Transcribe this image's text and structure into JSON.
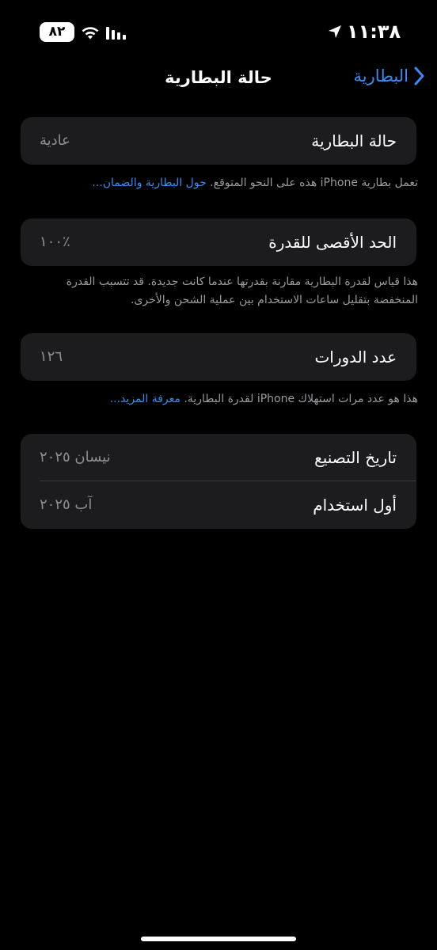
{
  "status_bar": {
    "time": "١١:٣٨",
    "battery_level": "٨٢",
    "location_icon": "location-arrow-icon",
    "wifi_icon": "wifi-icon",
    "signal_icon": "cellular-signal-icon"
  },
  "nav": {
    "title": "حالة البطارية",
    "back_label": "البطارية",
    "back_icon": "chevron-left-icon"
  },
  "sections": {
    "health": {
      "label": "حالة البطارية",
      "value": "عادية",
      "footnote_text": "تعمل بطارية iPhone هذه على النحو المتوقع. ",
      "footnote_link": "حول البطارية والضمان..."
    },
    "max_capacity": {
      "label": "الحد الأقصى للقدرة",
      "value": "٪١٠٠",
      "footnote_text": "هذا قياس لقدرة البطارية مقارنة بقدرتها عندما كانت جديدة. قد تتسبب القدرة المنخفضة بتقليل ساعات الاستخدام بين عملية الشحن والأخرى."
    },
    "cycle_count": {
      "label": "عدد الدورات",
      "value": "١٢٦",
      "footnote_text": "هذا هو عدد مرات استهلاك iPhone لقدرة البطارية. ",
      "footnote_link": "معرفة المزيد..."
    },
    "dates": {
      "manufacture_label": "تاريخ التصنيع",
      "manufacture_value": "نيسان ٢٠٢٥",
      "first_use_label": "أول استخدام",
      "first_use_value": "آب ٢٠٢٥"
    }
  },
  "colors": {
    "background": "#000000",
    "card": "#1c1c1e",
    "accent": "#3b8bf0",
    "secondary_text": "#8e8e93"
  }
}
